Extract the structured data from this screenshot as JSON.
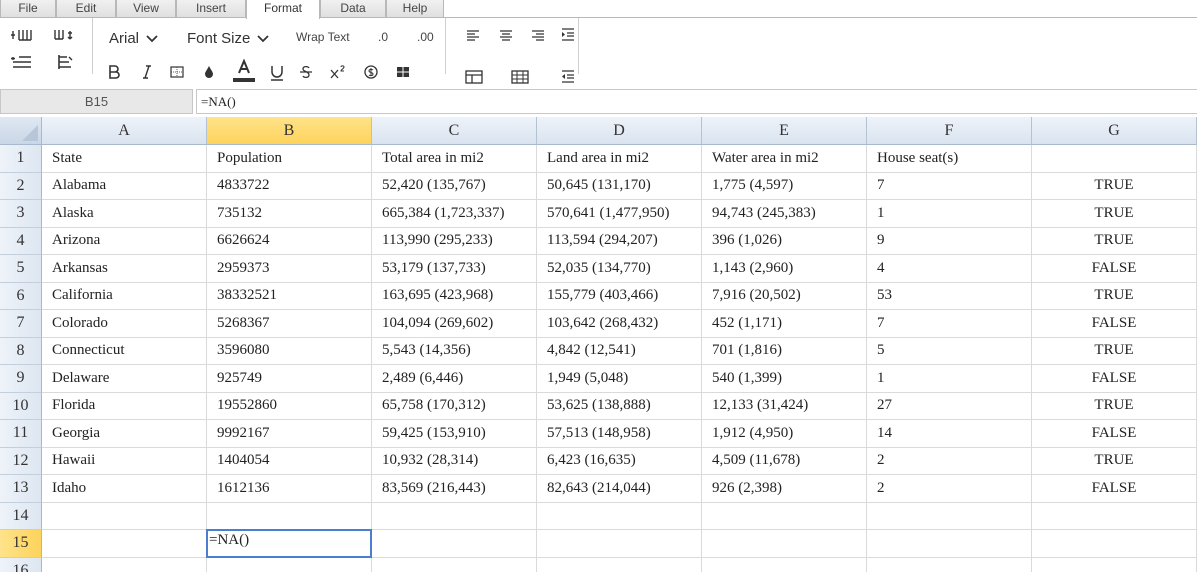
{
  "menu": {
    "tabs": [
      {
        "label": "File"
      },
      {
        "label": "Edit"
      },
      {
        "label": "View"
      },
      {
        "label": "Insert"
      },
      {
        "label": "Format"
      },
      {
        "label": "Data"
      },
      {
        "label": "Help"
      }
    ],
    "active_tab": "Format"
  },
  "toolbar": {
    "font_name": "Arial",
    "font_size_label": "Font Size",
    "wrap_text_label": "Wrap Text",
    "decimal_decrease_label": ".0",
    "decimal_increase_label": ".00"
  },
  "formula_bar": {
    "cell_ref": "B15",
    "formula": "=NA()"
  },
  "sheet": {
    "selected_column": "B",
    "selected_row": "15",
    "columns": [
      "A",
      "B",
      "C",
      "D",
      "E",
      "F",
      "G"
    ],
    "row_numbers": [
      "1",
      "2",
      "3",
      "4",
      "5",
      "6",
      "7",
      "8",
      "9",
      "10",
      "11",
      "12",
      "13",
      "14",
      "15",
      "16"
    ],
    "rows": [
      [
        "State",
        "Population",
        "Total area in mi2",
        "Land area in mi2",
        "Water area in mi2",
        "House seat(s)",
        ""
      ],
      [
        "Alabama",
        "4833722",
        "52,420 (135,767)",
        "50,645 (131,170)",
        "1,775 (4,597)",
        "7",
        "TRUE"
      ],
      [
        "Alaska",
        "735132",
        "665,384 (1,723,337)",
        "570,641 (1,477,950)",
        "94,743 (245,383)",
        "1",
        "TRUE"
      ],
      [
        "Arizona",
        "6626624",
        "113,990 (295,233)",
        "113,594 (294,207)",
        "396 (1,026)",
        "9",
        "TRUE"
      ],
      [
        "Arkansas",
        "2959373",
        "53,179 (137,733)",
        "52,035 (134,770)",
        "1,143 (2,960)",
        "4",
        "FALSE"
      ],
      [
        "California",
        "38332521",
        "163,695 (423,968)",
        "155,779 (403,466)",
        "7,916 (20,502)",
        "53",
        "TRUE"
      ],
      [
        "Colorado",
        "5268367",
        "104,094 (269,602)",
        "103,642 (268,432)",
        "452 (1,171)",
        "7",
        "FALSE"
      ],
      [
        "Connecticut",
        "3596080",
        "5,543 (14,356)",
        "4,842 (12,541)",
        "701 (1,816)",
        "5",
        "TRUE"
      ],
      [
        "Delaware",
        "925749",
        "2,489 (6,446)",
        "1,949 (5,048)",
        "540 (1,399)",
        "1",
        "FALSE"
      ],
      [
        "Florida",
        "19552860",
        "65,758 (170,312)",
        "53,625 (138,888)",
        "12,133 (31,424)",
        "27",
        "TRUE"
      ],
      [
        "Georgia",
        "9992167",
        "59,425 (153,910)",
        "57,513 (148,958)",
        "1,912 (4,950)",
        "14",
        "FALSE"
      ],
      [
        "Hawaii",
        "1404054",
        "10,932 (28,314)",
        "6,423 (16,635)",
        "4,509 (11,678)",
        "2",
        "TRUE"
      ],
      [
        "Idaho",
        "1612136",
        "83,569 (216,443)",
        "82,643 (214,044)",
        "926 (2,398)",
        "2",
        "FALSE"
      ],
      [
        "",
        "",
        "",
        "",
        "",
        "",
        ""
      ],
      [
        "",
        "=NA()",
        "",
        "",
        "",
        "",
        ""
      ],
      [
        "",
        "",
        "",
        "",
        "",
        "",
        ""
      ]
    ]
  },
  "colors": {
    "selection_header": "#fdd35b",
    "active_cell_border": "#4a7fd0",
    "header_bg": "#dde6f1"
  }
}
